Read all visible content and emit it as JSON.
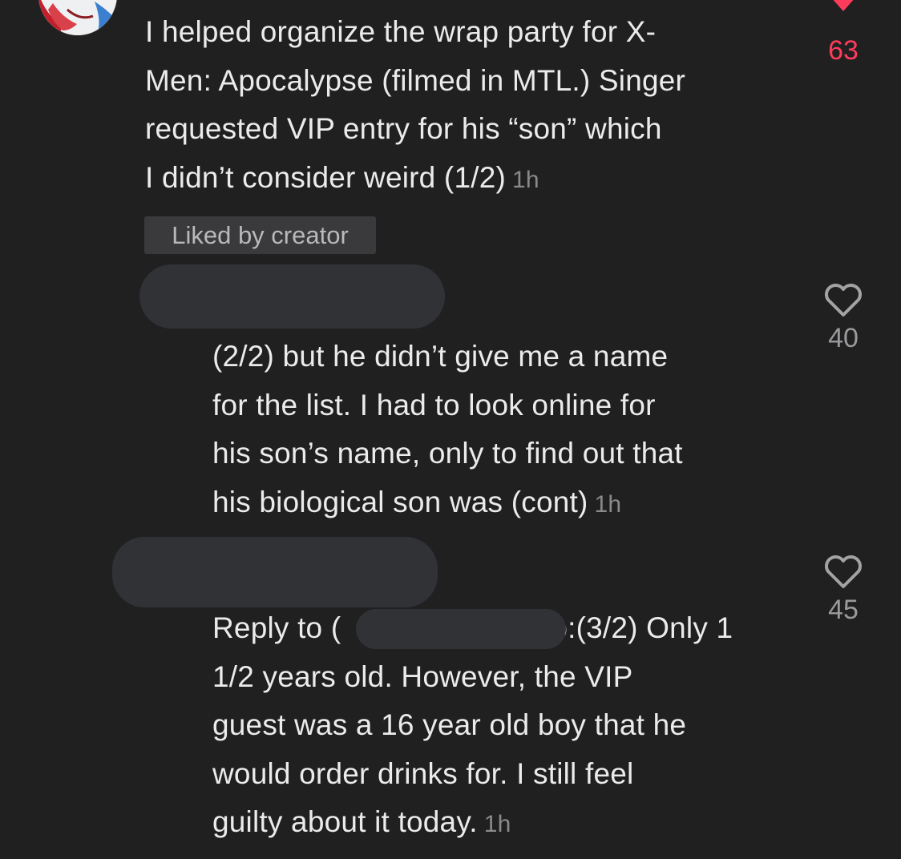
{
  "main_comment": {
    "lines": [
      "I helped organize the wrap party for X-",
      "Men: Apocalypse (filmed in MTL.) Singer",
      "requested VIP entry for his “son” which",
      "I didn’t consider weird (1/2)"
    ],
    "timestamp": "1h",
    "badge": "Liked by creator",
    "like_count": "63",
    "liked": true,
    "like_color": "#ff3b5c"
  },
  "replies": [
    {
      "lines": [
        "(2/2) but he didn’t give me a name",
        "for the list. I had to look online for",
        "his son’s name, only to find out that",
        "his biological son was (cont)"
      ],
      "timestamp": "1h",
      "like_count": "40",
      "liked": false
    },
    {
      "lines": [
        "Reply to (",
        "o:(3/2) Only 1",
        "1/2 years old. However, the VIP",
        "guest was a 16 year old boy that he",
        "would order drinks for. I still feel",
        "guilty about it today."
      ],
      "timestamp": "1h",
      "like_count": "45",
      "liked": false
    }
  ],
  "icons": {
    "like": "heart-icon"
  },
  "colors": {
    "background": "#202021",
    "text": "#ecebeb",
    "muted": "#8a8a8c",
    "redaction": "#303236"
  }
}
